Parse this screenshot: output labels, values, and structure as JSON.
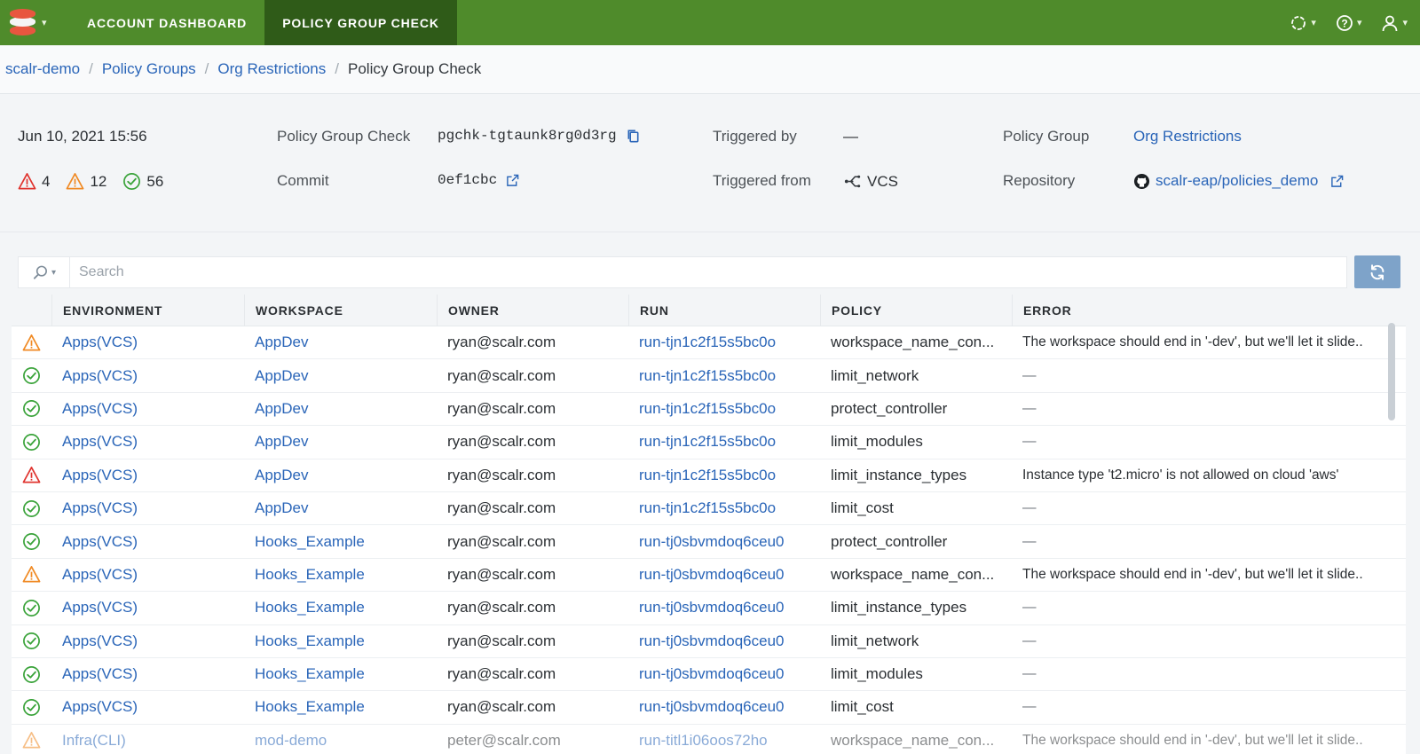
{
  "topbar": {
    "tabs": [
      {
        "label": "ACCOUNT DASHBOARD",
        "active": false
      },
      {
        "label": "POLICY GROUP CHECK",
        "active": true
      }
    ],
    "right_icons": [
      "status-circle-icon",
      "help-icon",
      "user-icon"
    ],
    "accent": "#4f8b2b"
  },
  "breadcrumb": {
    "items": [
      "scalr-demo",
      "Policy Groups",
      "Org Restrictions",
      "Policy Group Check"
    ]
  },
  "summary": {
    "date": "Jun 10, 2021 15:56",
    "counts": {
      "errors": "4",
      "warnings": "12",
      "passed": "56"
    },
    "policy_group_check_label": "Policy Group Check",
    "policy_group_check_id": "pgchk-tgtaunk8rg0d3rg",
    "commit_label": "Commit",
    "commit_value": "0ef1cbc",
    "triggered_by_label": "Triggered by",
    "triggered_by_value": "—",
    "triggered_from_label": "Triggered from",
    "triggered_from_value": "VCS",
    "policy_group_label": "Policy Group",
    "policy_group_value": "Org Restrictions",
    "repository_label": "Repository",
    "repository_value": "scalr-eap/policies_demo"
  },
  "search": {
    "placeholder": "Search",
    "value": ""
  },
  "table": {
    "columns": [
      "",
      "ENVIRONMENT",
      "WORKSPACE",
      "OWNER",
      "RUN",
      "POLICY",
      "ERROR"
    ],
    "rows": [
      {
        "status": "warning",
        "environment": "Apps(VCS)",
        "workspace": "AppDev",
        "owner": "ryan@scalr.com",
        "run": "run-tjn1c2f15s5bc0o",
        "policy": "workspace_name_con...",
        "error": "The workspace should end in '-dev', but we'll let it slide.."
      },
      {
        "status": "passed",
        "environment": "Apps(VCS)",
        "workspace": "AppDev",
        "owner": "ryan@scalr.com",
        "run": "run-tjn1c2f15s5bc0o",
        "policy": "limit_network",
        "error": "—"
      },
      {
        "status": "passed",
        "environment": "Apps(VCS)",
        "workspace": "AppDev",
        "owner": "ryan@scalr.com",
        "run": "run-tjn1c2f15s5bc0o",
        "policy": "protect_controller",
        "error": "—"
      },
      {
        "status": "passed",
        "environment": "Apps(VCS)",
        "workspace": "AppDev",
        "owner": "ryan@scalr.com",
        "run": "run-tjn1c2f15s5bc0o",
        "policy": "limit_modules",
        "error": "—"
      },
      {
        "status": "error",
        "environment": "Apps(VCS)",
        "workspace": "AppDev",
        "owner": "ryan@scalr.com",
        "run": "run-tjn1c2f15s5bc0o",
        "policy": "limit_instance_types",
        "error": "Instance type 't2.micro' is not allowed on cloud 'aws'"
      },
      {
        "status": "passed",
        "environment": "Apps(VCS)",
        "workspace": "AppDev",
        "owner": "ryan@scalr.com",
        "run": "run-tjn1c2f15s5bc0o",
        "policy": "limit_cost",
        "error": "—"
      },
      {
        "status": "passed",
        "environment": "Apps(VCS)",
        "workspace": "Hooks_Example",
        "owner": "ryan@scalr.com",
        "run": "run-tj0sbvmdoq6ceu0",
        "policy": "protect_controller",
        "error": "—"
      },
      {
        "status": "warning",
        "environment": "Apps(VCS)",
        "workspace": "Hooks_Example",
        "owner": "ryan@scalr.com",
        "run": "run-tj0sbvmdoq6ceu0",
        "policy": "workspace_name_con...",
        "error": "The workspace should end in '-dev', but we'll let it slide.."
      },
      {
        "status": "passed",
        "environment": "Apps(VCS)",
        "workspace": "Hooks_Example",
        "owner": "ryan@scalr.com",
        "run": "run-tj0sbvmdoq6ceu0",
        "policy": "limit_instance_types",
        "error": "—"
      },
      {
        "status": "passed",
        "environment": "Apps(VCS)",
        "workspace": "Hooks_Example",
        "owner": "ryan@scalr.com",
        "run": "run-tj0sbvmdoq6ceu0",
        "policy": "limit_network",
        "error": "—"
      },
      {
        "status": "passed",
        "environment": "Apps(VCS)",
        "workspace": "Hooks_Example",
        "owner": "ryan@scalr.com",
        "run": "run-tj0sbvmdoq6ceu0",
        "policy": "limit_modules",
        "error": "—"
      },
      {
        "status": "passed",
        "environment": "Apps(VCS)",
        "workspace": "Hooks_Example",
        "owner": "ryan@scalr.com",
        "run": "run-tj0sbvmdoq6ceu0",
        "policy": "limit_cost",
        "error": "—"
      },
      {
        "status": "warning",
        "environment": "Infra(CLI)",
        "workspace": "mod-demo",
        "owner": "peter@scalr.com",
        "run": "run-titl1i06oos72ho",
        "policy": "workspace_name_con...",
        "error": "The workspace should end in '-dev', but we'll let it slide.."
      }
    ]
  },
  "colors": {
    "link": "#2a65b8",
    "error": "#e0342f",
    "warning": "#f08a24",
    "passed": "#3aa33a",
    "refresh_button": "#7ea3c9"
  }
}
